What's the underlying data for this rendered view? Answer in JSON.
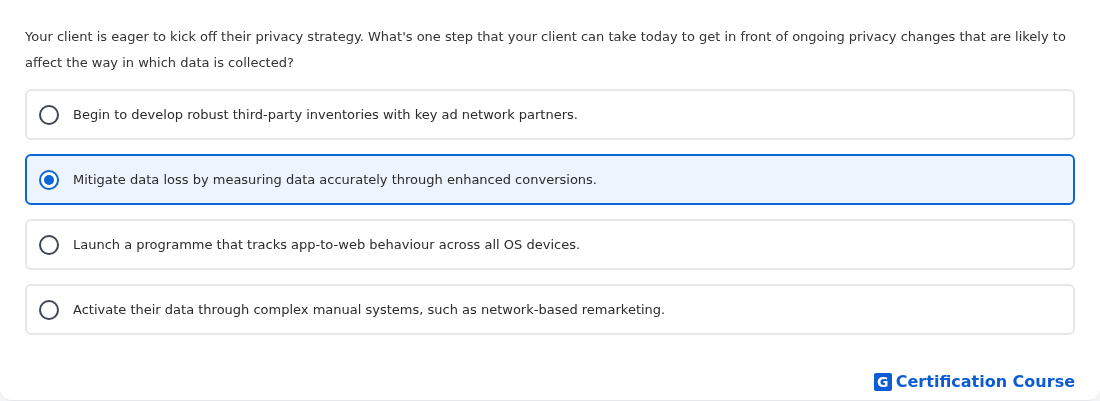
{
  "question": "Your client is eager to kick off their privacy strategy. What's one step that your client can take today to get in front of ongoing privacy changes that are likely to affect the way in which data is collected?",
  "options": [
    {
      "label": "Begin to develop robust third-party inventories with key ad network partners.",
      "selected": false
    },
    {
      "label": "Mitigate data loss by measuring data accurately through enhanced conversions.",
      "selected": true
    },
    {
      "label": "Launch a programme that tracks app-to-web behaviour across all OS devices.",
      "selected": false
    },
    {
      "label": "Activate their data through complex manual systems, such as network-based remarketing.",
      "selected": false
    }
  ],
  "brand": {
    "mark": "G",
    "name": "Certification Course"
  }
}
